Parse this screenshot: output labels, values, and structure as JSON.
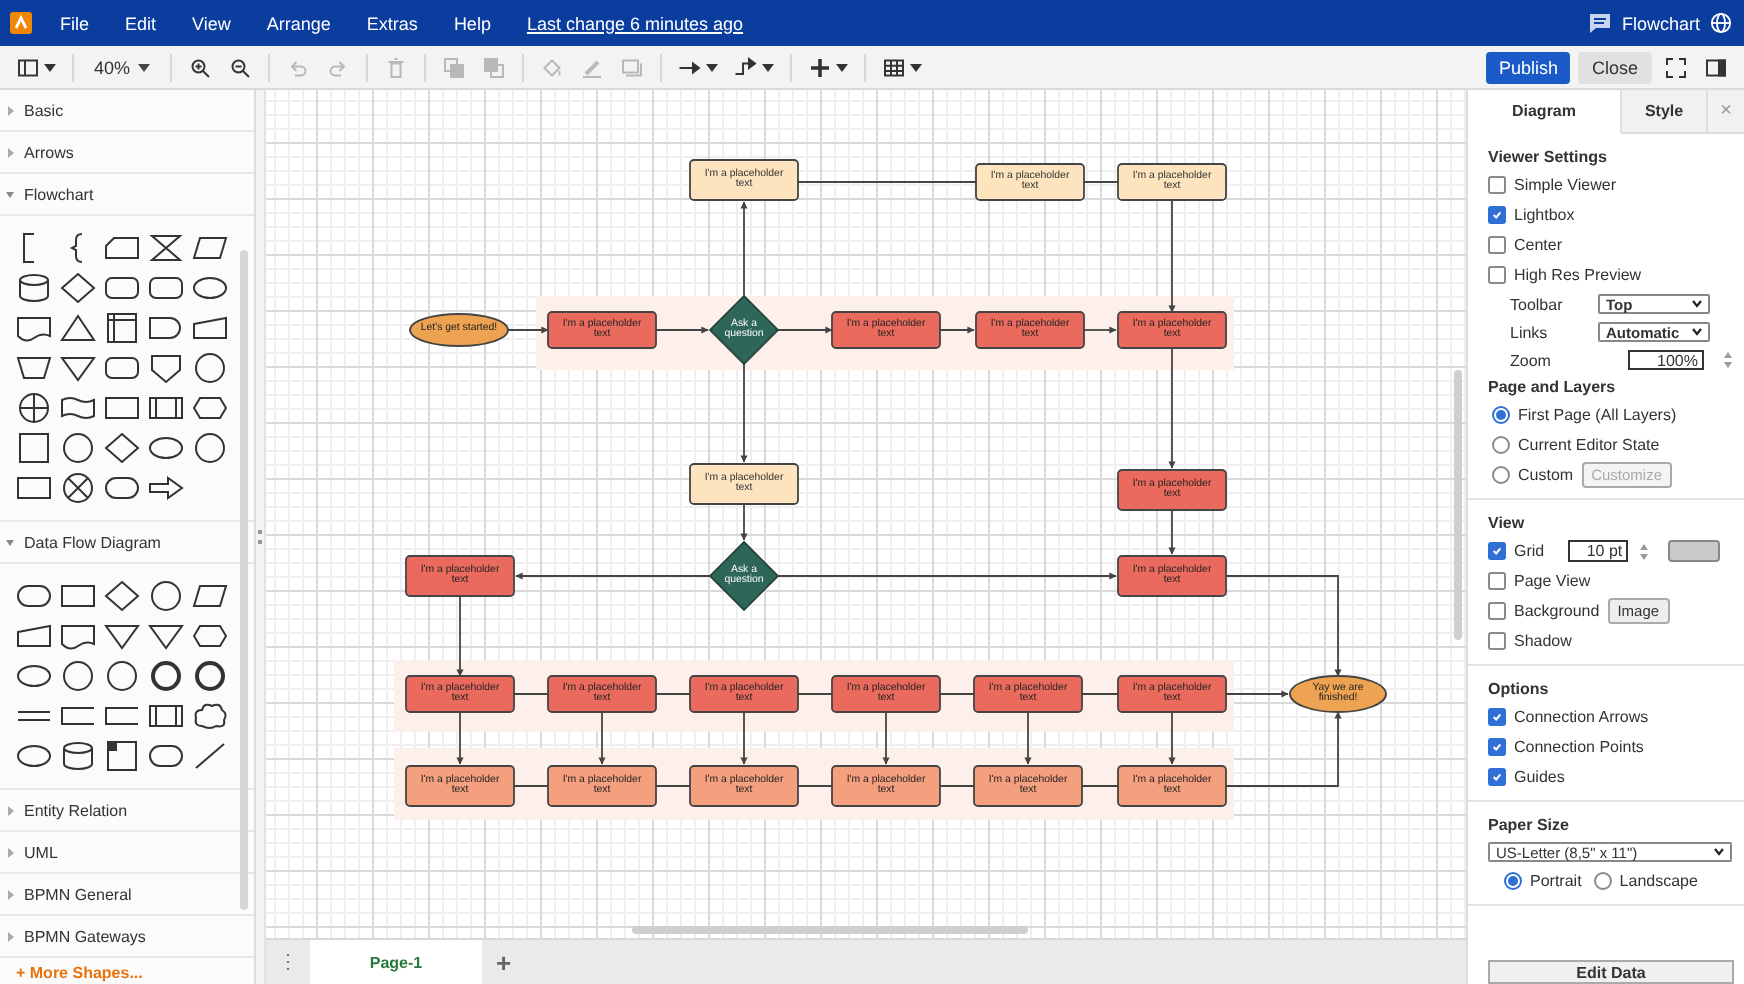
{
  "menubar": {
    "menus": [
      "File",
      "Edit",
      "View",
      "Arrange",
      "Extras",
      "Help"
    ],
    "last_change": "Last change 6 minutes ago",
    "document": "Flowchart"
  },
  "toolbar": {
    "zoom": "40%",
    "tools": [
      {
        "kind": "zoom-in",
        "disabled": false
      },
      {
        "kind": "zoom-out",
        "disabled": false
      },
      {
        "kind": "undo",
        "disabled": true
      },
      {
        "kind": "redo",
        "disabled": true
      },
      {
        "kind": "delete",
        "disabled": true
      },
      {
        "kind": "to-front",
        "disabled": true
      },
      {
        "kind": "to-back",
        "disabled": true
      },
      {
        "kind": "fill",
        "disabled": true
      },
      {
        "kind": "line",
        "disabled": true
      },
      {
        "kind": "shadow",
        "disabled": true
      },
      {
        "kind": "connection",
        "disabled": false
      },
      {
        "kind": "waypoints",
        "disabled": false
      },
      {
        "kind": "insert",
        "disabled": false
      },
      {
        "kind": "table",
        "disabled": false
      }
    ],
    "publish": "Publish",
    "close": "Close"
  },
  "sidebar": {
    "sections": [
      {
        "title": "Basic",
        "expanded": false
      },
      {
        "title": "Arrows",
        "expanded": false
      },
      {
        "title": "Flowchart",
        "expanded": true
      },
      {
        "title": "Data Flow Diagram",
        "expanded": true
      },
      {
        "title": "Entity Relation",
        "expanded": false
      },
      {
        "title": "UML",
        "expanded": false
      },
      {
        "title": "BPMN General",
        "expanded": false
      },
      {
        "title": "BPMN Gateways",
        "expanded": false
      }
    ],
    "more_shapes": "+ More Shapes..."
  },
  "diagram": {
    "nodes": [
      {
        "kind": "note",
        "text": "I'm a placeholder text"
      },
      {
        "kind": "note",
        "text": "I'm a placeholder text"
      },
      {
        "kind": "note",
        "text": "I'm a placeholder text"
      },
      {
        "kind": "start",
        "text": "Let's get started!"
      },
      {
        "kind": "process",
        "text": "I'm a placeholder text"
      },
      {
        "kind": "decision",
        "text": "Ask a question"
      },
      {
        "kind": "process",
        "text": "I'm a placeholder text"
      },
      {
        "kind": "process",
        "text": "I'm a placeholder text"
      },
      {
        "kind": "process",
        "text": "I'm a placeholder text"
      },
      {
        "kind": "note",
        "text": "I'm a placeholder text"
      },
      {
        "kind": "process",
        "text": "I'm a placeholder text"
      },
      {
        "kind": "process",
        "text": "I'm a placeholder text"
      },
      {
        "kind": "decision",
        "text": "Ask a question"
      },
      {
        "kind": "process",
        "text": "I'm a placeholder text"
      },
      {
        "kind": "process",
        "text": "I'm a placeholder text"
      },
      {
        "kind": "process",
        "text": "I'm a placeholder text"
      },
      {
        "kind": "process",
        "text": "I'm a placeholder text"
      },
      {
        "kind": "process",
        "text": "I'm a placeholder text"
      },
      {
        "kind": "process",
        "text": "I'm a placeholder text"
      },
      {
        "kind": "process",
        "text": "I'm a placeholder text"
      },
      {
        "kind": "end",
        "text": "Yay we are finished!"
      },
      {
        "kind": "step",
        "text": "I'm a placeholder text"
      },
      {
        "kind": "step",
        "text": "I'm a placeholder text"
      },
      {
        "kind": "step",
        "text": "I'm a placeholder text"
      },
      {
        "kind": "step",
        "text": "I'm a placeholder text"
      },
      {
        "kind": "step",
        "text": "I'm a placeholder text"
      },
      {
        "kind": "step",
        "text": "I'm a placeholder text"
      }
    ]
  },
  "format_panel": {
    "tabs": [
      {
        "label": "Diagram",
        "selected": true
      },
      {
        "label": "Style",
        "selected": false
      }
    ],
    "close": "×",
    "sections": [
      {
        "rows": [
          {
            "kind": "heading",
            "text": "Viewer Settings"
          },
          {
            "kind": "checkbox",
            "label": "Simple Viewer",
            "checked": false
          },
          {
            "kind": "checkbox",
            "label": "Lightbox",
            "checked": true
          },
          {
            "kind": "checkbox",
            "label": "Center",
            "checked": false
          },
          {
            "kind": "checkbox",
            "label": "High Res Preview",
            "checked": false
          },
          {
            "kind": "select",
            "label": "Toolbar",
            "value": "Top"
          },
          {
            "kind": "select",
            "label": "Links",
            "value": "Automatic"
          },
          {
            "kind": "spinner",
            "label": "Zoom",
            "value": "100%"
          },
          {
            "kind": "heading",
            "text": "Page and Layers"
          },
          {
            "kind": "radio",
            "label": "First Page (All Layers)",
            "selected": true
          },
          {
            "kind": "radio",
            "label": "Current Editor State",
            "selected": false
          },
          {
            "kind": "radio",
            "label": "Custom",
            "selected": false,
            "button": {
              "label": "Customize",
              "disabled": true
            }
          }
        ]
      },
      {
        "rows": [
          {
            "kind": "heading",
            "text": "View"
          },
          {
            "kind": "grid",
            "label": "Grid",
            "checked": true,
            "value": "10 pt"
          },
          {
            "kind": "checkbox",
            "label": "Page View",
            "checked": false
          },
          {
            "kind": "checkbox",
            "label": "Background",
            "checked": false,
            "button": {
              "label": "Image",
              "disabled": false
            }
          },
          {
            "kind": "checkbox",
            "label": "Shadow",
            "checked": false
          }
        ]
      },
      {
        "rows": [
          {
            "kind": "heading",
            "text": "Options"
          },
          {
            "kind": "checkbox",
            "label": "Connection Arrows",
            "checked": true
          },
          {
            "kind": "checkbox",
            "label": "Connection Points",
            "checked": true
          },
          {
            "kind": "checkbox",
            "label": "Guides",
            "checked": true
          }
        ]
      },
      {
        "rows": [
          {
            "kind": "heading",
            "text": "Paper Size"
          },
          {
            "kind": "select",
            "value": "US-Letter (8,5\" x 11\")"
          },
          {
            "kind": "radio-row",
            "options": [
              {
                "label": "Portrait",
                "selected": true
              },
              {
                "label": "Landscape",
                "selected": false
              }
            ]
          }
        ]
      }
    ],
    "edit_data": "Edit Data"
  },
  "pages": {
    "menu": "⋮",
    "tabs": [
      {
        "label": "Page-1",
        "selected": true
      }
    ],
    "add": "+"
  }
}
